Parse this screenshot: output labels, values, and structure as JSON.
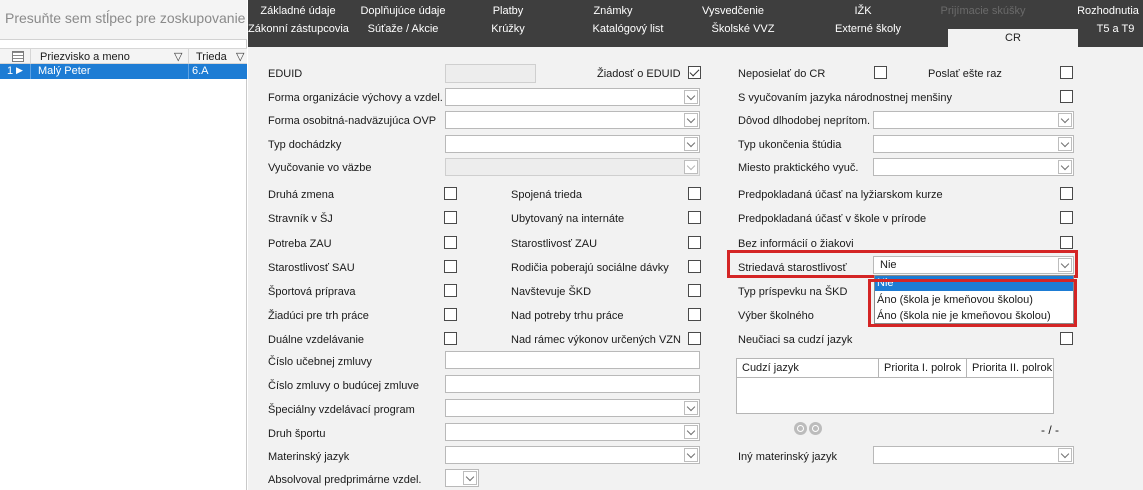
{
  "left_panel": {
    "group_hint": "Presuňte sem stĺpec pre zoskupovanie ho",
    "columns": [
      "Priezvisko a meno",
      "Trieda"
    ],
    "rows": [
      {
        "num": "1",
        "name": "Malý Peter",
        "class": "6.A"
      }
    ]
  },
  "tabs": {
    "row1": [
      "Základné údaje",
      "Doplňujúce údaje",
      "Platby",
      "Známky",
      "Vysvedčenie",
      "IŽK",
      "Prijímacie skúšky",
      "Rozhodnutia"
    ],
    "row2": [
      "Zákonní zástupcovia",
      "Súťaže / Akcie",
      "Krúžky",
      "Katalógový list",
      "Školské VVZ",
      "Externé školy",
      "CR",
      "T5 a T9"
    ],
    "active": "CR"
  },
  "form": {
    "eduid_label": "EDUID",
    "eduid_request_label": "Žiadosť o EDUID",
    "forma_org_label": "Forma organizácie výchovy a vzdel.",
    "forma_osob_label": "Forma osobitná-nadväzujúca OVP",
    "typ_dochadzky_label": "Typ dochádzky",
    "vyucovanie_vazba_label": "Vyučovanie vo väzbe",
    "checks_col1": [
      "Druhá zmena",
      "Stravník v ŠJ",
      "Potreba ZAU",
      "Starostlivosť SAU",
      "Športová príprava",
      "Žiadúci pre trh práce",
      "Duálne vzdelávanie"
    ],
    "checks_col2": [
      "Spojená trieda",
      "Ubytovaný na internáte",
      "Starostlivosť ZAU",
      "Rodičia poberajú sociálne dávky",
      "Navštevuje ŠKD",
      "Nad potreby trhu práce",
      "Nad rámec výkonov určených VZN"
    ],
    "cislo_ucebnej_label": "Číslo učebnej zmluvy",
    "cislo_buducej_label": "Číslo zmluvy o budúcej zmluve",
    "specialny_label": "Špeciálny vzdelávací program",
    "druh_sportu_label": "Druh športu",
    "materinsky_label": "Materinský jazyk",
    "predprimarne_label": "Absolvoval predprimárne vzdel.",
    "neposielat_label": "Neposielať do CR",
    "poslat_znova_label": "Poslať ešte raz",
    "narodnostna_label": "S vyučovaním jazyka národnostnej menšiny",
    "dovod_label": "Dôvod dlhodobej neprítom.",
    "typ_ukoncenia_label": "Typ ukončenia štúdia",
    "miesto_label": "Miesto praktického vyuč.",
    "lyziarsky_label": "Predpokladaná účasť na lyžiarskom kurze",
    "skola_prirode_label": "Predpokladaná účasť v škole v prírode",
    "bez_informacii_label": "Bez informácií o žiakovi",
    "striedava_label": "Striedavá starostlivosť",
    "striedava_value": "Nie",
    "striedava_options": [
      "Nie",
      "Áno (škola je kmeňovou školou)",
      "Áno (škola nie je kmeňovou školou)"
    ],
    "typ_prispevku_label": "Typ príspevku na ŠKD",
    "vyber_skolneho_label": "Výber školného",
    "neuciaci_label": "Neučiaci sa cudzí jazyk",
    "lang_table_headers": [
      "Cudzí jazyk",
      "Priorita I. polrok",
      "Priorita II. polrok"
    ],
    "lang_counter": "- / -",
    "iny_materinsky_label": "Iný materinský jazyk"
  },
  "colors": {
    "accent": "#1d7cd4",
    "tab_bar": "#3e3e3e",
    "highlight": "#d42525"
  }
}
